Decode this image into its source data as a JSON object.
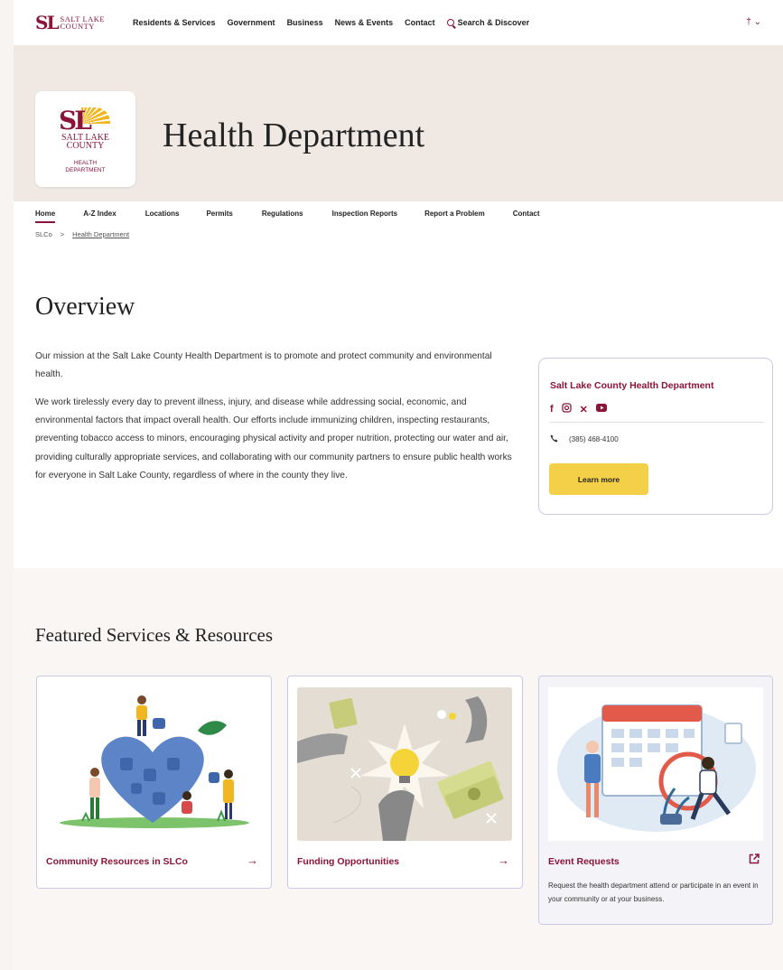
{
  "topnav": {
    "logo_words": [
      "SALT LAKE",
      "COUNTY"
    ],
    "items": [
      "Residents & Services",
      "Government",
      "Business",
      "News & Events",
      "Contact"
    ],
    "search_label": "Search & Discover"
  },
  "hero": {
    "badge_org": [
      "SALT LAKE",
      "COUNTY"
    ],
    "badge_dept": [
      "HEALTH",
      "DEPARTMENT"
    ],
    "title": "Health Department"
  },
  "subnav": {
    "items": [
      "Home",
      "A-Z Index",
      "Locations",
      "Permits",
      "Regulations",
      "Inspection Reports",
      "Report a Problem",
      "Contact"
    ],
    "active": "Home"
  },
  "breadcrumb": {
    "root": "SLCo",
    "separator": ">",
    "current": "Health Department"
  },
  "overview": {
    "title": "Overview",
    "paragraph1": "Our mission at the Salt Lake County Health Department is to promote and protect community and environmental health.",
    "paragraph2": "We work tirelessly every day to prevent illness, injury, and disease while addressing social, economic, and environmental factors that impact overall health. Our efforts include immunizing children, inspecting restaurants, preventing tobacco access to minors, encouraging physical activity and proper nutrition, protecting our water and air, providing culturally appropriate services, and collaborating with our community partners to ensure public health works for everyone in Salt Lake County, regardless of where in the county they live."
  },
  "contact_card": {
    "name": "Salt Lake County Health Department",
    "social_icons": [
      "facebook-icon",
      "instagram-icon",
      "x-icon",
      "youtube-icon"
    ],
    "phone": "(385) 468-4100",
    "button_label": "Learn more"
  },
  "featured": {
    "title": "Featured Services & Resources",
    "cards": [
      {
        "title": "Community Resources in SLCo",
        "icon": "arrow-right-icon"
      },
      {
        "title": "Funding Opportunities",
        "icon": "arrow-right-icon"
      },
      {
        "title": "Event Requests",
        "icon": "external-link-icon",
        "description": "Request the health department attend or participate in an event in your community or at your business."
      }
    ]
  },
  "colors": {
    "brand": "#8a1538",
    "accent_yellow": "#f4cf48",
    "hero_bg": "#efe8e3",
    "card_border": "#c9cbe6"
  }
}
